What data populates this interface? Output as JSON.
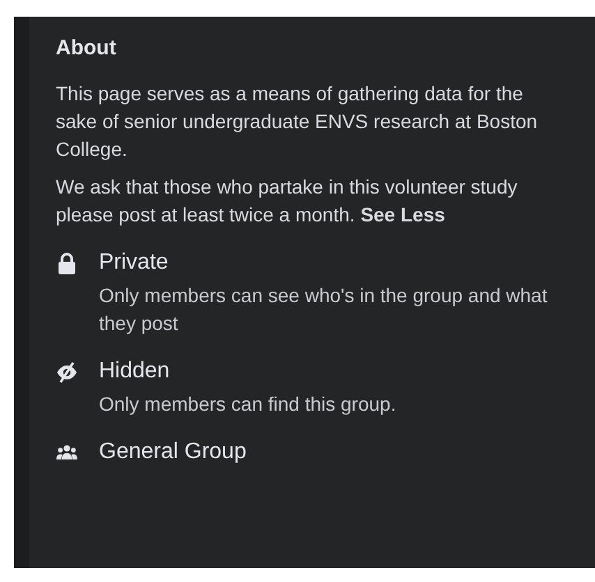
{
  "about": {
    "title": "About",
    "paragraphs": [
      "This page serves as a means of gathering data for the sake of senior undergraduate ENVS research at Boston College.",
      "We ask that those who partake in this volunteer study please post at least twice a month. **See Less**"
    ],
    "details": [
      {
        "kind": "lock",
        "title": "Private",
        "description": "Only members can see who's in the group and what they post"
      },
      {
        "kind": "hidden",
        "title": "Hidden",
        "description": "Only members can find this group."
      },
      {
        "kind": "group",
        "title": "General Group"
      }
    ]
  }
}
